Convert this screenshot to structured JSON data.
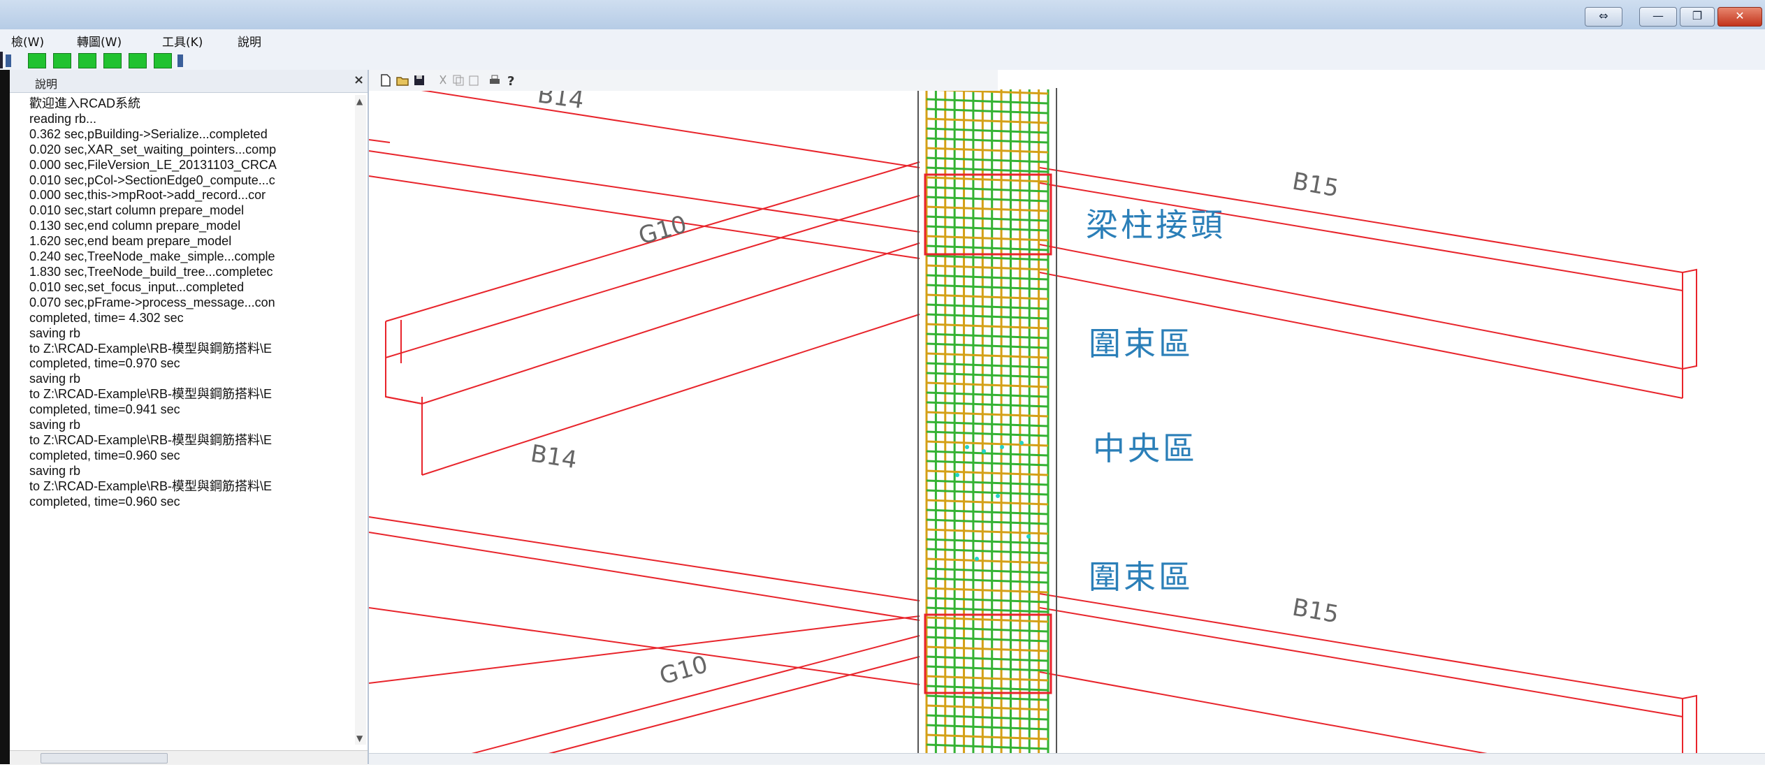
{
  "window": {
    "buttons": [
      "⇔",
      "—",
      "❐",
      "✕"
    ]
  },
  "menu": {
    "items": [
      "檢(W)",
      "轉圖(W)",
      "工具(K)",
      "說明"
    ]
  },
  "left_panel": {
    "title": "說明",
    "close": "×",
    "log_lines": [
      "歡迎進入RCAD系統",
      "reading rb...",
      "0.362 sec,pBuilding->Serialize...completed",
      "0.020 sec,XAR_set_waiting_pointers...comp",
      "0.000 sec,FileVersion_LE_20131103_CRCA",
      "0.010 sec,pCol->SectionEdge0_compute...c",
      "0.000 sec,this->mpRoot->add_record...cor",
      "0.010 sec,start column prepare_model",
      "0.130 sec,end column prepare_model",
      "1.620 sec,end beam prepare_model",
      "0.240 sec,TreeNode_make_simple...comple",
      "1.830 sec,TreeNode_build_tree...completec",
      "0.010 sec,set_focus_input...completed",
      "0.070 sec,pFrame->process_message...con",
      "  completed, time= 4.302 sec",
      "saving rb",
      " to Z:\\RCAD-Example\\RB-模型與鋼筋搭料\\E",
      "completed, time=0.970 sec",
      "saving rb",
      " to Z:\\RCAD-Example\\RB-模型與鋼筋搭料\\E",
      "completed, time=0.941 sec",
      "saving rb",
      " to Z:\\RCAD-Example\\RB-模型與鋼筋搭料\\E",
      "completed, time=0.960 sec",
      "saving rb",
      " to Z:\\RCAD-Example\\RB-模型與鋼筋搭料\\E",
      "completed, time=0.960 sec"
    ]
  },
  "viewport": {
    "annotations": [
      "梁柱接頭",
      "圍束區",
      "中央區",
      "圍束區"
    ],
    "beam_labels": [
      "B14",
      "B15",
      "G10",
      "B14",
      "G10",
      "B15"
    ]
  },
  "colors": {
    "beam_line": "#e8242b",
    "rebar_orange": "#d4a017",
    "rebar_green": "#34b233",
    "annotation_text": "#2b7fb8",
    "cyan_marker": "#22d3c7"
  }
}
